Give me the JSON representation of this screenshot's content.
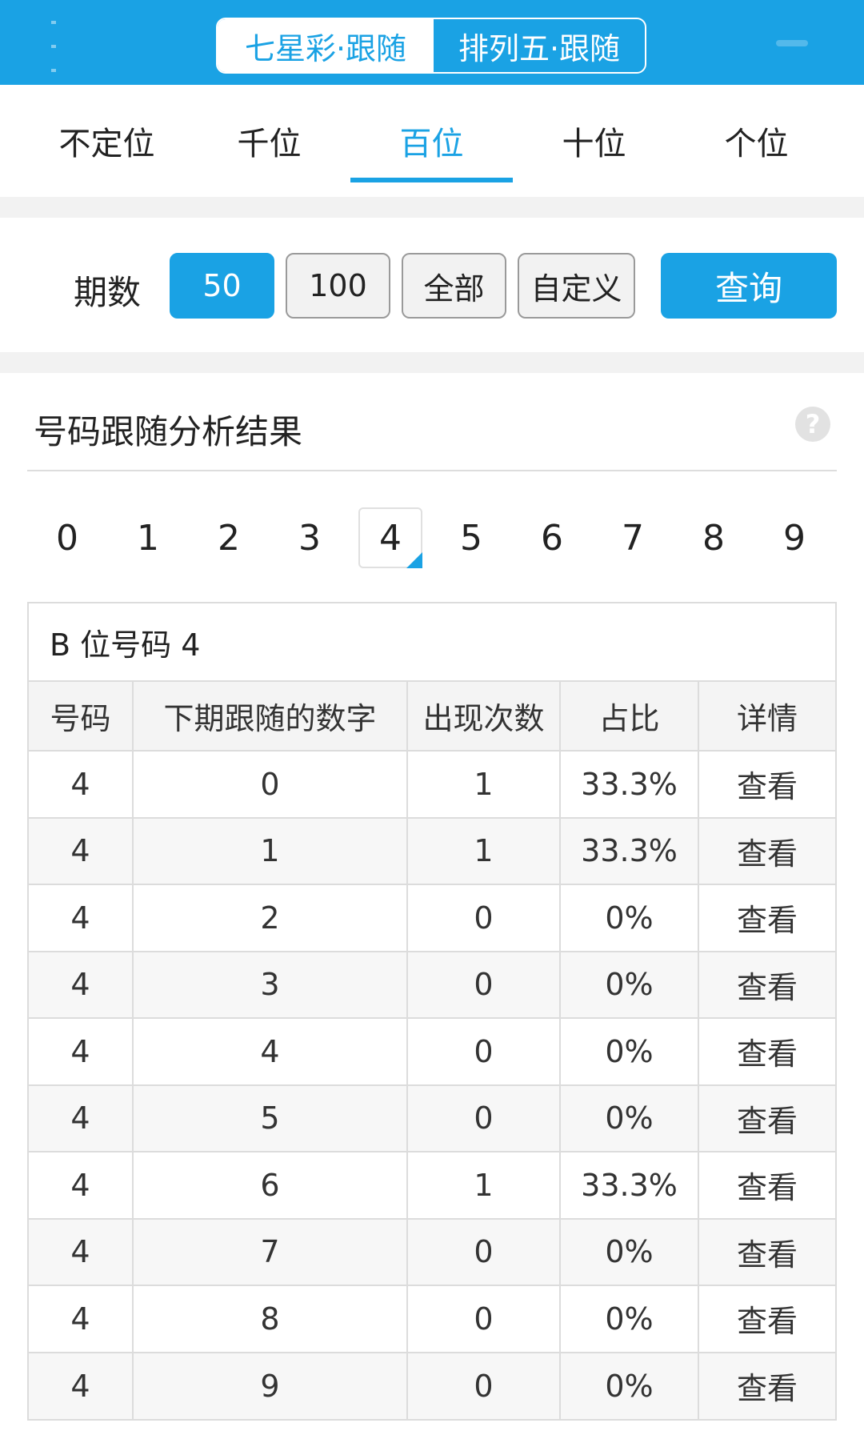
{
  "lottery_tabs": [
    {
      "label": "七星彩·跟随",
      "active": true
    },
    {
      "label": "排列五·跟随",
      "active": false
    }
  ],
  "position_tabs": [
    {
      "label": "不定位",
      "active": false
    },
    {
      "label": "千位",
      "active": false
    },
    {
      "label": "百位",
      "active": true
    },
    {
      "label": "十位",
      "active": false
    },
    {
      "label": "个位",
      "active": false
    }
  ],
  "period": {
    "label": "期数",
    "options": [
      {
        "label": "50",
        "active": true
      },
      {
        "label": "100",
        "active": false
      },
      {
        "label": "全部",
        "active": false
      },
      {
        "label": "自定义",
        "active": false
      }
    ],
    "query_label": "查询"
  },
  "result_section": {
    "title": "号码跟随分析结果",
    "help_icon": "question-circle-icon"
  },
  "digits": [
    {
      "label": "0",
      "active": false
    },
    {
      "label": "1",
      "active": false
    },
    {
      "label": "2",
      "active": false
    },
    {
      "label": "3",
      "active": false
    },
    {
      "label": "4",
      "active": true
    },
    {
      "label": "5",
      "active": false
    },
    {
      "label": "6",
      "active": false
    },
    {
      "label": "7",
      "active": false
    },
    {
      "label": "8",
      "active": false
    },
    {
      "label": "9",
      "active": false
    }
  ],
  "table": {
    "caption": "B 位号码 4",
    "columns": [
      "号码",
      "下期跟随的数字",
      "出现次数",
      "占比",
      "详情"
    ],
    "rows": [
      [
        "4",
        "0",
        "1",
        "33.3%",
        "查看"
      ],
      [
        "4",
        "1",
        "1",
        "33.3%",
        "查看"
      ],
      [
        "4",
        "2",
        "0",
        "0%",
        "查看"
      ],
      [
        "4",
        "3",
        "0",
        "0%",
        "查看"
      ],
      [
        "4",
        "4",
        "0",
        "0%",
        "查看"
      ],
      [
        "4",
        "5",
        "0",
        "0%",
        "查看"
      ],
      [
        "4",
        "6",
        "1",
        "33.3%",
        "查看"
      ],
      [
        "4",
        "7",
        "0",
        "0%",
        "查看"
      ],
      [
        "4",
        "8",
        "0",
        "0%",
        "查看"
      ],
      [
        "4",
        "9",
        "0",
        "0%",
        "查看"
      ]
    ]
  },
  "colors": {
    "accent": "#1aa2e4",
    "row_alt": "#f7f7f7",
    "page_gap": "#f2f2f2"
  }
}
